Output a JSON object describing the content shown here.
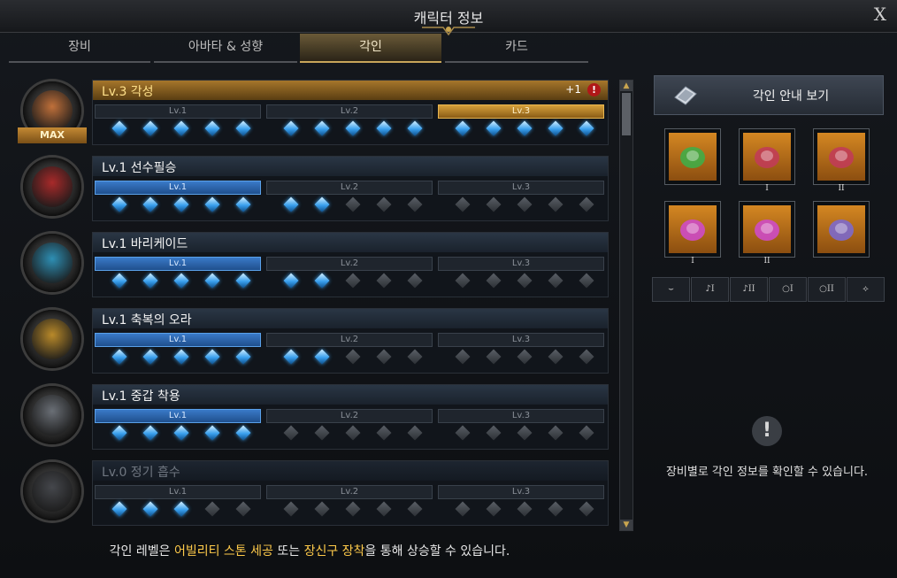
{
  "window": {
    "title": "캐릭터 정보",
    "close_label": "X"
  },
  "tabs": [
    {
      "label": "장비",
      "active": false
    },
    {
      "label": "아바타 & 성향",
      "active": false
    },
    {
      "label": "각인",
      "active": true
    },
    {
      "label": "카드",
      "active": false
    }
  ],
  "level_labels": [
    "Lv.1",
    "Lv.2",
    "Lv.3"
  ],
  "engravings": [
    {
      "name": "Lv.3 각성",
      "level": 3,
      "max": true,
      "badge": "MAX",
      "bonus": "+1",
      "alert": "!",
      "gems": [
        5,
        5,
        5
      ],
      "color": "#c0703a"
    },
    {
      "name": "Lv.1 선수필승",
      "level": 1,
      "gems": [
        5,
        2,
        0
      ],
      "color": "#a82a2a"
    },
    {
      "name": "Lv.1 바리케이드",
      "level": 1,
      "gems": [
        5,
        2,
        0
      ],
      "color": "#2e8fb4"
    },
    {
      "name": "Lv.1 축복의 오라",
      "level": 1,
      "gems": [
        5,
        2,
        0
      ],
      "color": "#b98a2a"
    },
    {
      "name": "Lv.1 중갑 착용",
      "level": 1,
      "gems": [
        5,
        0,
        0
      ],
      "color": "#6a6f76"
    },
    {
      "name": "Lv.0 정기 흡수",
      "level": 0,
      "gems": [
        3,
        0,
        0
      ],
      "color": "#45474c"
    }
  ],
  "footer": {
    "prefix": "각인 레벨은 ",
    "hl1": "어빌리티 스톤 세공",
    "mid": " 또는 ",
    "hl2": "장신구 장착",
    "suffix": "을 통해 상승할 수 있습니다."
  },
  "guide_button": "각인 안내 보기",
  "equipment_slots": [
    {
      "icon": "necklace-icon",
      "numeral": ""
    },
    {
      "icon": "earring-icon",
      "numeral": "I"
    },
    {
      "icon": "earring-icon",
      "numeral": "II"
    },
    {
      "icon": "ring-icon",
      "numeral": "I"
    },
    {
      "icon": "ring-icon",
      "numeral": "II"
    },
    {
      "icon": "ability-stone-icon",
      "numeral": ""
    }
  ],
  "filter_buttons": [
    {
      "icon": "necklace-filter-icon",
      "numeral": ""
    },
    {
      "icon": "earring-filter-icon",
      "numeral": "I"
    },
    {
      "icon": "earring-filter-icon",
      "numeral": "II"
    },
    {
      "icon": "ring-filter-icon",
      "numeral": "I"
    },
    {
      "icon": "ring-filter-icon",
      "numeral": "II"
    },
    {
      "icon": "stone-filter-icon",
      "numeral": ""
    }
  ],
  "info_message": "장비별로 각인 정보를 확인할 수 있습니다."
}
